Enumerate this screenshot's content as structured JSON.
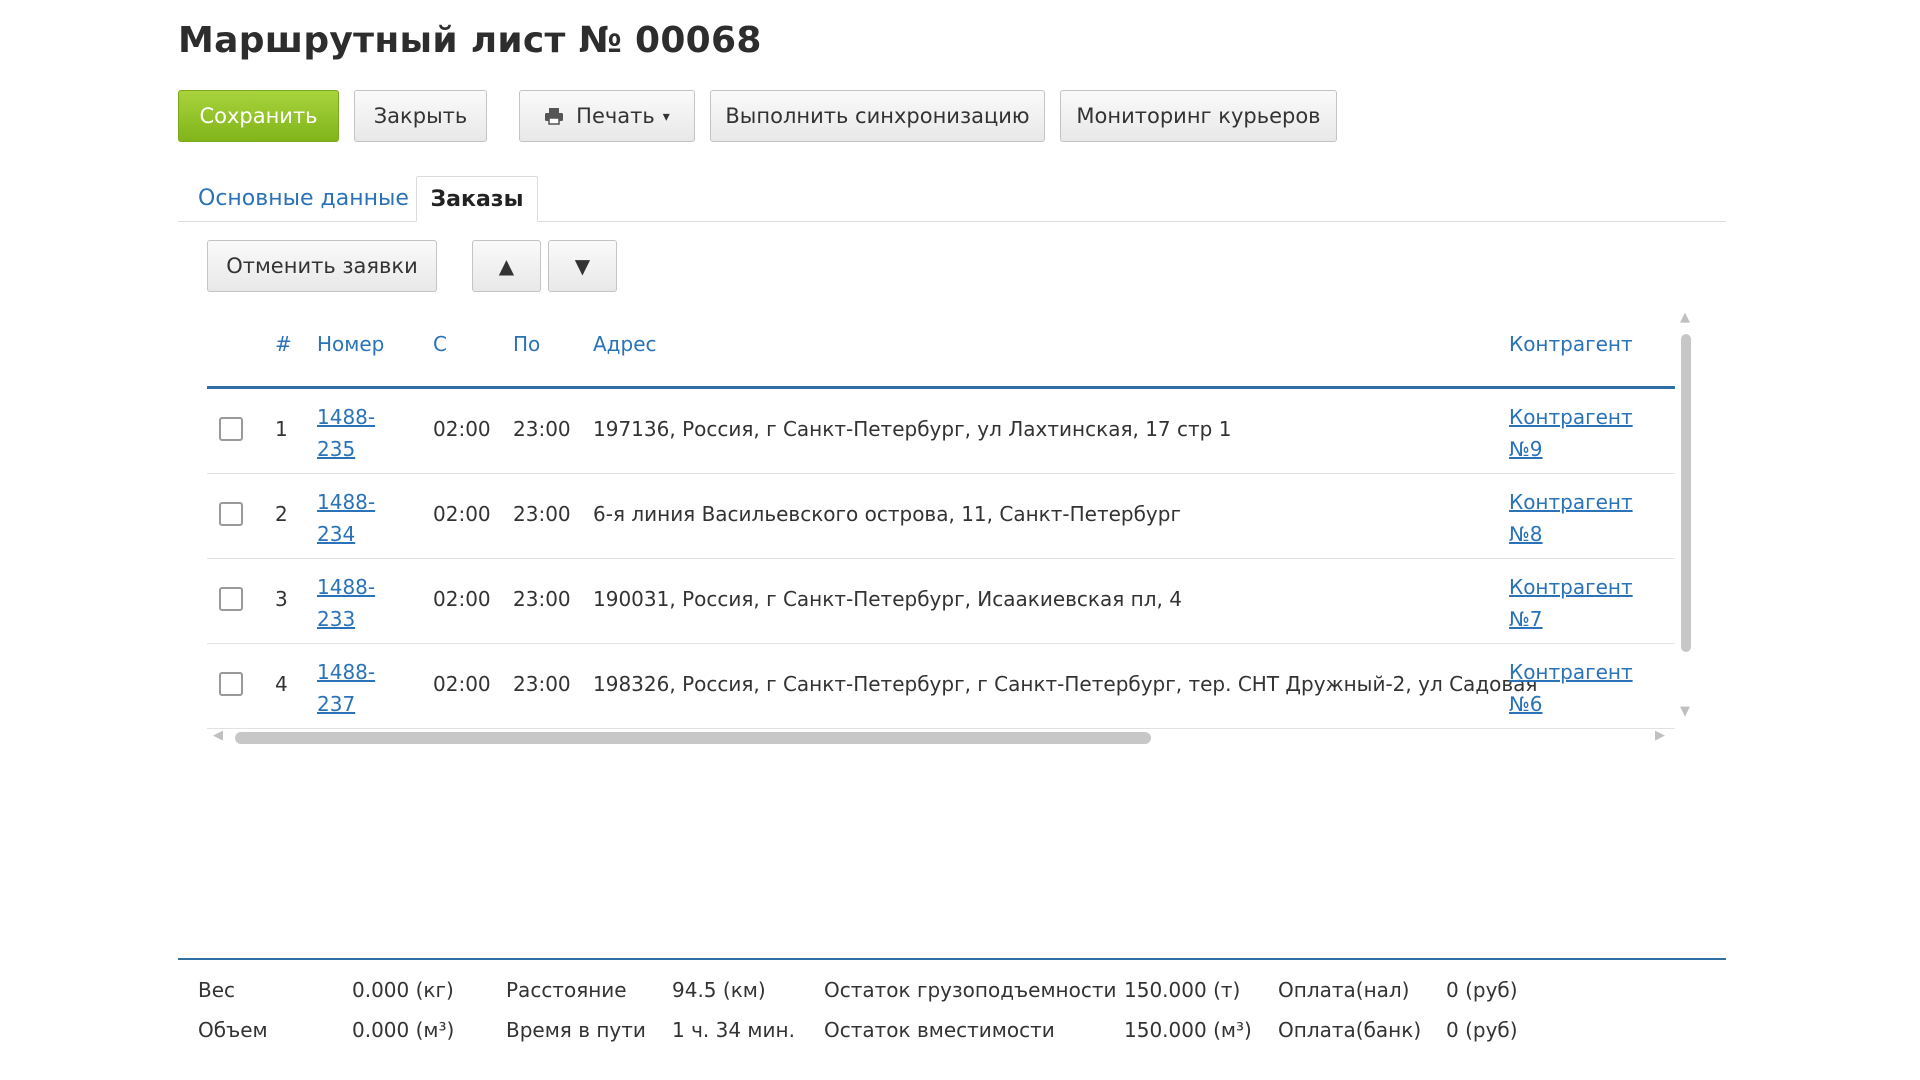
{
  "page": {
    "title": "Маршрутный лист № 00068"
  },
  "toolbar": {
    "save_label": "Сохранить",
    "close_label": "Закрыть",
    "print_label": "Печать",
    "sync_label": "Выполнить синхронизацию",
    "monitoring_label": "Мониторинг курьеров",
    "save_color": "#8dc21f"
  },
  "tabs": [
    {
      "label": "Основные данные",
      "active": false
    },
    {
      "label": "Заказы",
      "active": true
    }
  ],
  "order_tools": {
    "cancel_label": "Отменить заявки",
    "up_label": "▲",
    "down_label": "▼"
  },
  "table": {
    "columns": {
      "index": "#",
      "number": "Номер",
      "from": "С",
      "to": "По",
      "address": "Адрес",
      "counterparty": "Контрагент"
    },
    "rows": [
      {
        "index": "1",
        "number_line1": "1488-",
        "number_line2": "235",
        "from": "02:00",
        "to": "23:00",
        "address": "197136, Россия, г Санкт-Петербург, ул Лахтинская, 17 стр 1",
        "counterparty_line1": "Контрагент",
        "counterparty_line2": "№9",
        "checked": false
      },
      {
        "index": "2",
        "number_line1": "1488-",
        "number_line2": "234",
        "from": "02:00",
        "to": "23:00",
        "address": "6-я линия Васильевского острова, 11, Санкт-Петербург",
        "counterparty_line1": "Контрагент",
        "counterparty_line2": "№8",
        "checked": false
      },
      {
        "index": "3",
        "number_line1": "1488-",
        "number_line2": "233",
        "from": "02:00",
        "to": "23:00",
        "address": "190031, Россия, г Санкт-Петербург, Исаакиевская пл, 4",
        "counterparty_line1": "Контрагент",
        "counterparty_line2": "№7",
        "checked": false
      },
      {
        "index": "4",
        "number_line1": "1488-",
        "number_line2": "237",
        "from": "02:00",
        "to": "23:00",
        "address": "198326, Россия, г Санкт-Петербург, г Санкт-Петербург, тер. СНТ Дружный-2, ул Садовая",
        "counterparty_line1": "Контрагент",
        "counterparty_line2": "№6",
        "checked": false
      }
    ]
  },
  "footer": {
    "weight_label": "Вес",
    "weight_value": "0.000 (кг)",
    "volume_label": "Объем",
    "volume_value": "0.000 (м³)",
    "distance_label": "Расстояние",
    "distance_value": "94.5 (км)",
    "travel_time_label": "Время в пути",
    "travel_time_value": "1 ч. 34 мин.",
    "capacity_left_label": "Остаток грузоподъемности",
    "capacity_left_value": "150.000 (т)",
    "volume_left_label": "Остаток вместимости",
    "volume_left_value": "150.000 (м³)",
    "cash_label": "Оплата(нал)",
    "cash_value": "0 (руб)",
    "bank_label": "Оплата(банк)",
    "bank_value": "0 (руб)"
  }
}
